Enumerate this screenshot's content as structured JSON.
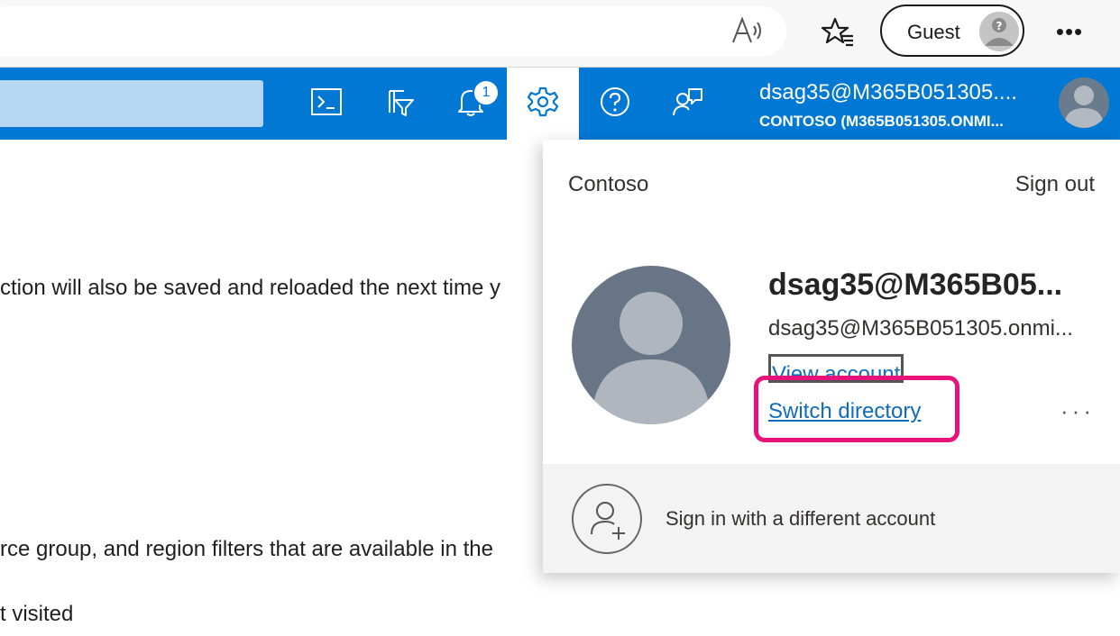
{
  "browser": {
    "guest_label": "Guest",
    "more_label": "•••",
    "icons": [
      "read-aloud-icon",
      "favorites-icon",
      "guest-avatar-icon",
      "more-icon"
    ]
  },
  "header": {
    "notification_count": "1",
    "account_name": "dsag35@M365B051305....",
    "account_tenant": "CONTOSO (M365B051305.ONMI...",
    "accent_color": "#0078d4",
    "icons": [
      "cloud-shell-icon",
      "directory-filter-icon",
      "bell-icon",
      "gear-icon",
      "help-icon",
      "feedback-icon",
      "user-avatar-icon"
    ]
  },
  "content": {
    "lines": [
      "ction will also be saved and reloaded the next time y",
      "rce group, and region filters that are available in the",
      "t visited"
    ]
  },
  "flyout": {
    "org": "Contoso",
    "sign_out": "Sign out",
    "display_name": "dsag35@M365B05...",
    "email": "dsag35@M365B051305.onmi...",
    "view_account": "View account",
    "switch_directory": "Switch directory",
    "more": "···",
    "sign_in_different": "Sign in with a different account",
    "highlight_color": "#e8137a"
  }
}
